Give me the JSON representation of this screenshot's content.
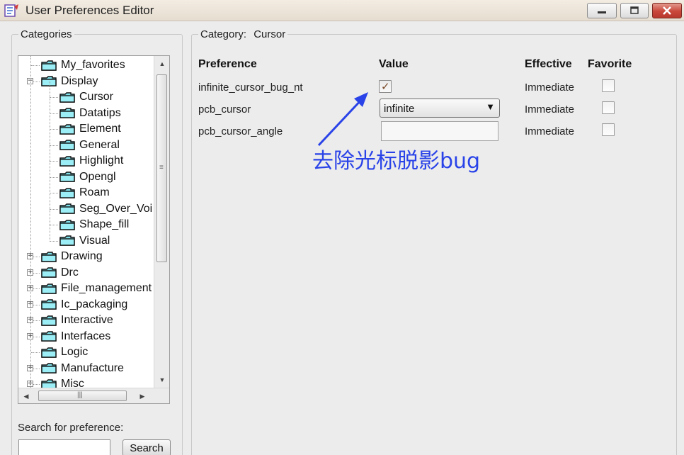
{
  "window": {
    "title": "User Preferences Editor",
    "accent": "#2a43e8"
  },
  "left_panel": {
    "legend": "Categories",
    "tree": [
      {
        "label": "My_favorites",
        "level": 0,
        "expander": "none"
      },
      {
        "label": "Display",
        "level": 0,
        "expander": "minus"
      },
      {
        "label": "Cursor",
        "level": 1,
        "expander": "none",
        "selected": true
      },
      {
        "label": "Datatips",
        "level": 1,
        "expander": "none"
      },
      {
        "label": "Element",
        "level": 1,
        "expander": "none"
      },
      {
        "label": "General",
        "level": 1,
        "expander": "none"
      },
      {
        "label": "Highlight",
        "level": 1,
        "expander": "none"
      },
      {
        "label": "Opengl",
        "level": 1,
        "expander": "none"
      },
      {
        "label": "Roam",
        "level": 1,
        "expander": "none"
      },
      {
        "label": "Seg_Over_Voi",
        "level": 1,
        "expander": "none"
      },
      {
        "label": "Shape_fill",
        "level": 1,
        "expander": "none"
      },
      {
        "label": "Visual",
        "level": 1,
        "expander": "none"
      },
      {
        "label": "Drawing",
        "level": 0,
        "expander": "plus"
      },
      {
        "label": "Drc",
        "level": 0,
        "expander": "plus"
      },
      {
        "label": "File_management",
        "level": 0,
        "expander": "plus"
      },
      {
        "label": "Ic_packaging",
        "level": 0,
        "expander": "plus"
      },
      {
        "label": "Interactive",
        "level": 0,
        "expander": "plus"
      },
      {
        "label": "Interfaces",
        "level": 0,
        "expander": "plus"
      },
      {
        "label": "Logic",
        "level": 0,
        "expander": "none"
      },
      {
        "label": "Manufacture",
        "level": 0,
        "expander": "plus"
      },
      {
        "label": "Misc",
        "level": 0,
        "expander": "plus"
      }
    ],
    "search": {
      "label": "Search for preference:",
      "value": "",
      "button": "Search"
    }
  },
  "right_panel": {
    "legend_prefix": "Category:",
    "legend_value": "Cursor",
    "headers": {
      "preference": "Preference",
      "value": "Value",
      "effective": "Effective",
      "favorite": "Favorite"
    },
    "rows": [
      {
        "name": "infinite_cursor_bug_nt",
        "control": "checkbox",
        "checked": true,
        "effective": "Immediate",
        "favorite": false
      },
      {
        "name": "pcb_cursor",
        "control": "select",
        "value": "infinite",
        "effective": "Immediate",
        "favorite": false
      },
      {
        "name": "pcb_cursor_angle",
        "control": "text",
        "value": "",
        "effective": "Immediate",
        "favorite": false
      }
    ],
    "annotation": "去除光标脱影bug"
  }
}
